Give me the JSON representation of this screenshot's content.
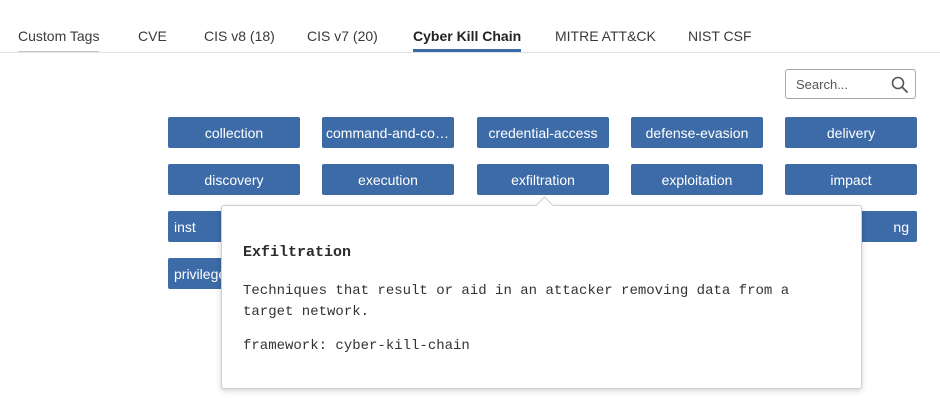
{
  "tabs": [
    {
      "label": "Custom Tags"
    },
    {
      "label": "CVE"
    },
    {
      "label": "CIS v8 (18)"
    },
    {
      "label": "CIS v7 (20)"
    },
    {
      "label": "Cyber Kill Chain",
      "active": true
    },
    {
      "label": "MITRE ATT&CK"
    },
    {
      "label": "NIST CSF"
    }
  ],
  "search": {
    "placeholder": "Search...",
    "icon": "search-icon"
  },
  "tags": {
    "row1": [
      "collection",
      "command-and-control",
      "credential-access",
      "defense-evasion",
      "delivery"
    ],
    "row2": [
      "discovery",
      "execution",
      "exfiltration",
      "exploitation",
      "impact"
    ],
    "row3_left_visible": "inst",
    "row3_right_visible": "ng",
    "row4_left_visible": "privilege"
  },
  "tooltip": {
    "title": "Exfiltration",
    "description": "Techniques that result or aid in an attacker removing data from a target network.",
    "framework": "framework: cyber-kill-chain"
  },
  "colors": {
    "chip": "#3c6ba7",
    "active_tab_underline": "#3a6aa8"
  }
}
